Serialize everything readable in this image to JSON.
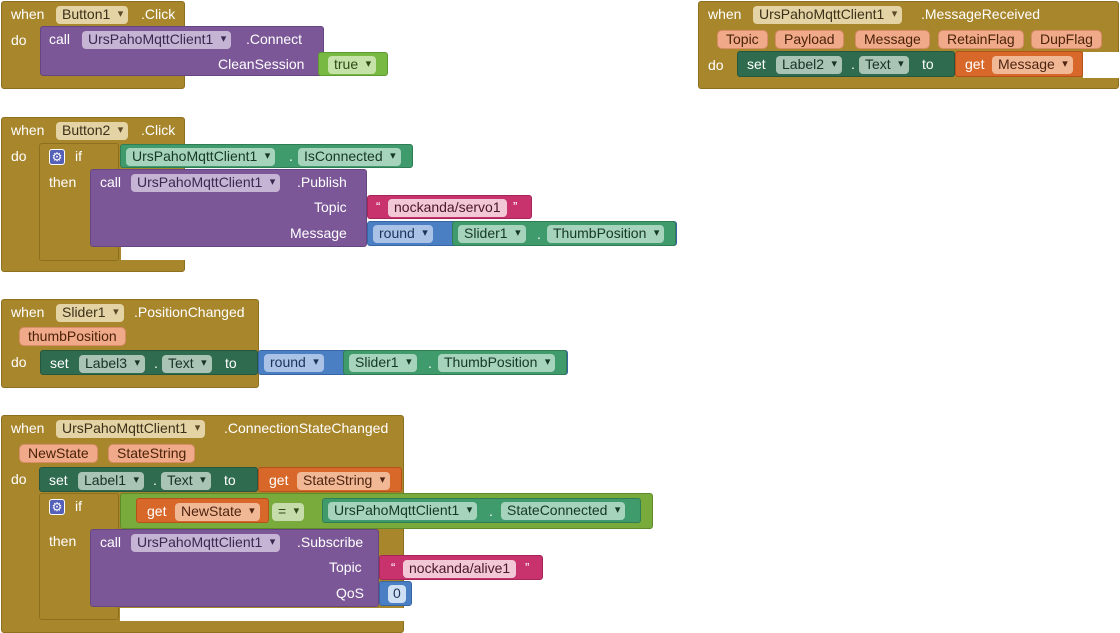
{
  "kw": {
    "when": "when",
    "do": "do",
    "call": "call",
    "set": "set",
    "to": "to",
    "get": "get",
    "if": "if",
    "then": "then",
    "dot": ".",
    "eq": "=",
    "open_quote": "“",
    "close_quote": "”"
  },
  "block1": {
    "component": "Button1",
    "event": ".Click",
    "method": ".Connect",
    "arg_label": "CleanSession",
    "value": "true"
  },
  "block2": {
    "component": "UrsPahoMqttClient1",
    "event": ".MessageReceived",
    "params": [
      "Topic",
      "Payload",
      "Message",
      "RetainFlag",
      "DupFlag"
    ],
    "set_component": "Label2",
    "set_property": "Text",
    "get_var": "Message"
  },
  "block3": {
    "component": "Button2",
    "event": ".Click",
    "cond_component": "UrsPahoMqttClient1",
    "cond_property": "IsConnected",
    "call_component": "UrsPahoMqttClient1",
    "method": ".Publish",
    "arg1_label": "Topic",
    "topic_value": "nockanda/servo1",
    "arg2_label": "Message",
    "math_op": "round",
    "slider": "Slider1",
    "slider_property": "ThumbPosition"
  },
  "block4": {
    "component": "Slider1",
    "event": ".PositionChanged",
    "param": "thumbPosition",
    "set_component": "Label3",
    "set_property": "Text",
    "math_op": "round",
    "slider": "Slider1",
    "slider_property": "ThumbPosition"
  },
  "block5": {
    "component": "UrsPahoMqttClient1",
    "event": ".ConnectionStateChanged",
    "params": [
      "NewState",
      "StateString"
    ],
    "set_component": "Label1",
    "set_property": "Text",
    "get_var": "StateString",
    "cond_get_var": "NewState",
    "cond_op": "=",
    "cond_component": "UrsPahoMqttClient1",
    "cond_property": "StateConnected",
    "call_component": "UrsPahoMqttClient1",
    "method": ".Subscribe",
    "arg1_label": "Topic",
    "topic_value": "nockanda/alive1",
    "arg2_label": "QoS",
    "qos_value": "0"
  },
  "colors": {
    "event": "#a8862c",
    "procedure": "#7b5797",
    "setter": "#2f6b4e",
    "component_getter": "#3f9a6c",
    "logic": "#79ab3c",
    "math": "#4b7fc4",
    "text": "#c8326d",
    "variable_get": "#d7682a",
    "param": "#f0aa8a"
  },
  "icons": {
    "mutator": "gear-icon",
    "dropdown": "dropdown-arrow-icon"
  }
}
